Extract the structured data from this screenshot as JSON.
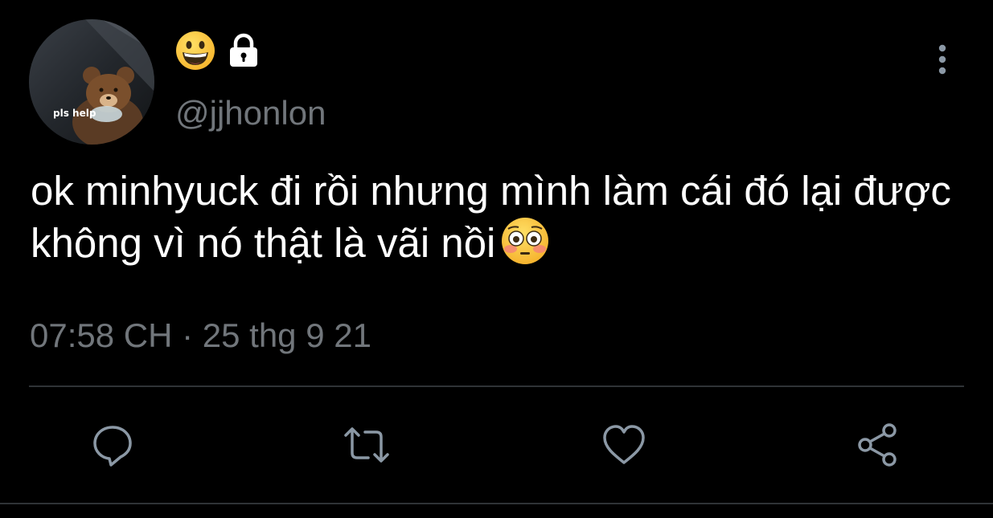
{
  "user": {
    "avatar_caption": "pls help",
    "display_name_emoji": "grinning-face-emoji",
    "protected_badge": "lock-icon",
    "handle": "@jjhonlon"
  },
  "tweet": {
    "text": "ok minhyuck đi rồi nhưng mình làm cái đó lại được không vì nó thật là vãi nồi",
    "trailing_emoji": "flushed-face-emoji",
    "timestamp": "07:58 CH · 25 thg 9 21"
  },
  "actions": [
    {
      "name": "reply",
      "icon": "comment-icon"
    },
    {
      "name": "retweet",
      "icon": "retweet-icon"
    },
    {
      "name": "like",
      "icon": "heart-icon"
    },
    {
      "name": "share",
      "icon": "share-icon"
    }
  ],
  "colors": {
    "background": "#000000",
    "text": "#ffffff",
    "secondary_text": "#71767b",
    "icon": "#8b98a5",
    "divider": "#2f3336"
  }
}
